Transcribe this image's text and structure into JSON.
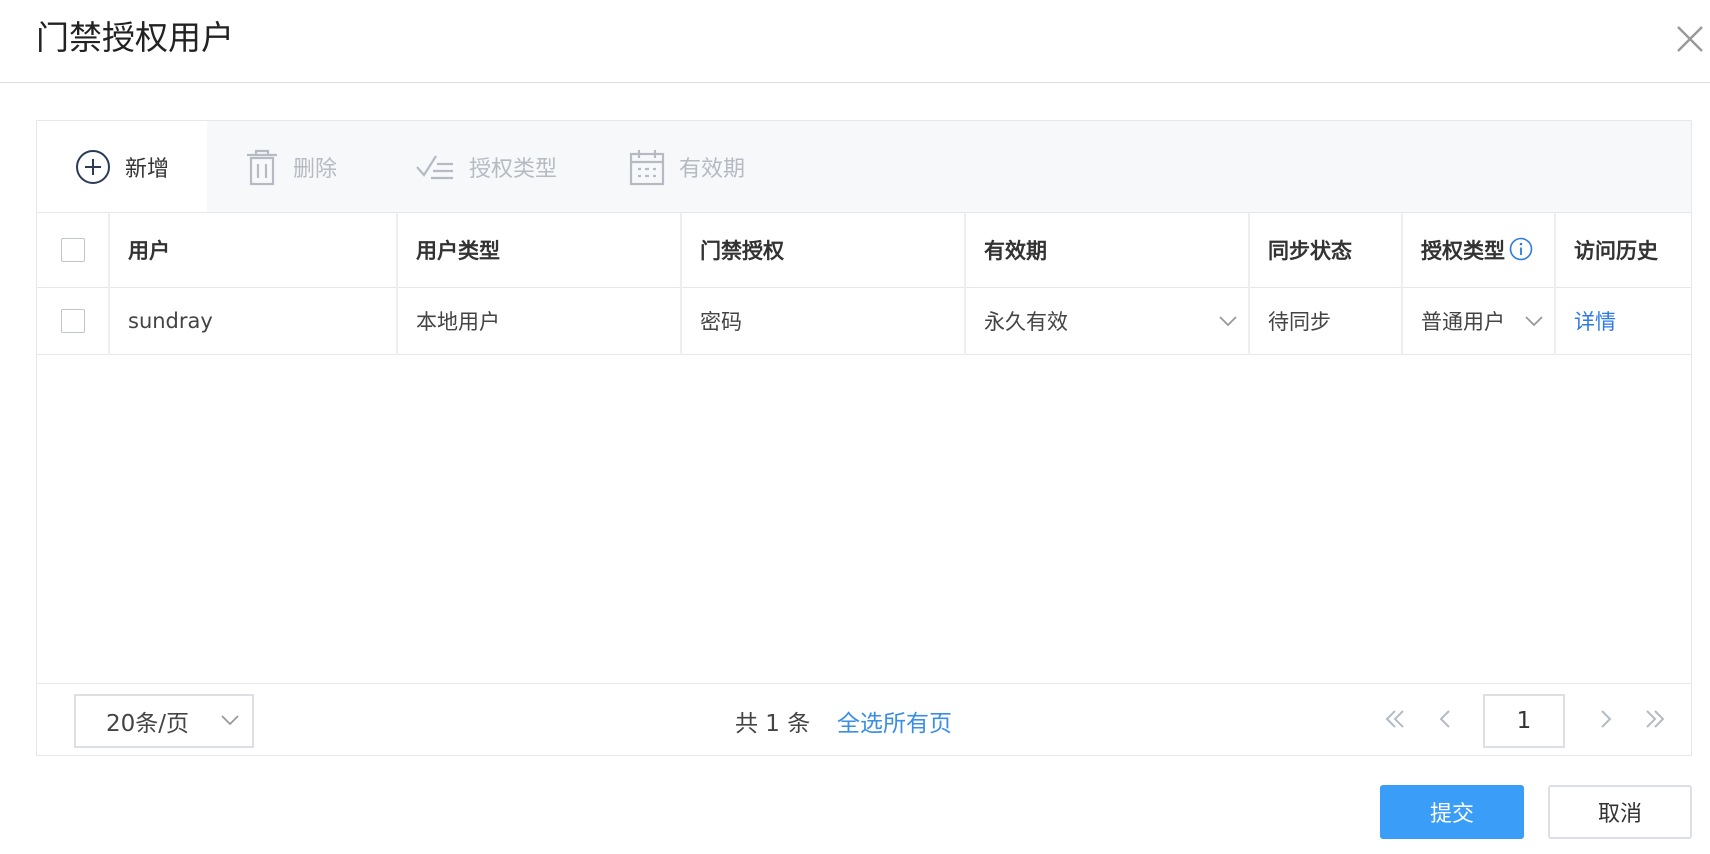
{
  "dialog": {
    "title": "门禁授权用户"
  },
  "toolbar": {
    "add_label": "新增",
    "delete_label": "删除",
    "auth_type_label": "授权类型",
    "validity_label": "有效期"
  },
  "table": {
    "headers": {
      "user": "用户",
      "user_type": "用户类型",
      "access_auth": "门禁授权",
      "validity": "有效期",
      "sync_status": "同步状态",
      "auth_type": "授权类型",
      "history": "访问历史"
    },
    "rows": [
      {
        "user": "sundray",
        "user_type": "本地用户",
        "access_auth": "密码",
        "validity": "永久有效",
        "sync_status": "待同步",
        "auth_type": "普通用户",
        "history": "详情"
      }
    ]
  },
  "pagination": {
    "page_size": "20条/页",
    "total": "共 1 条",
    "select_all": "全选所有页",
    "current_page": "1"
  },
  "actions": {
    "submit": "提交",
    "cancel": "取消"
  },
  "colors": {
    "primary": "#3a9df7",
    "link": "#2d7ae0",
    "disabled": "#b5bac3"
  }
}
